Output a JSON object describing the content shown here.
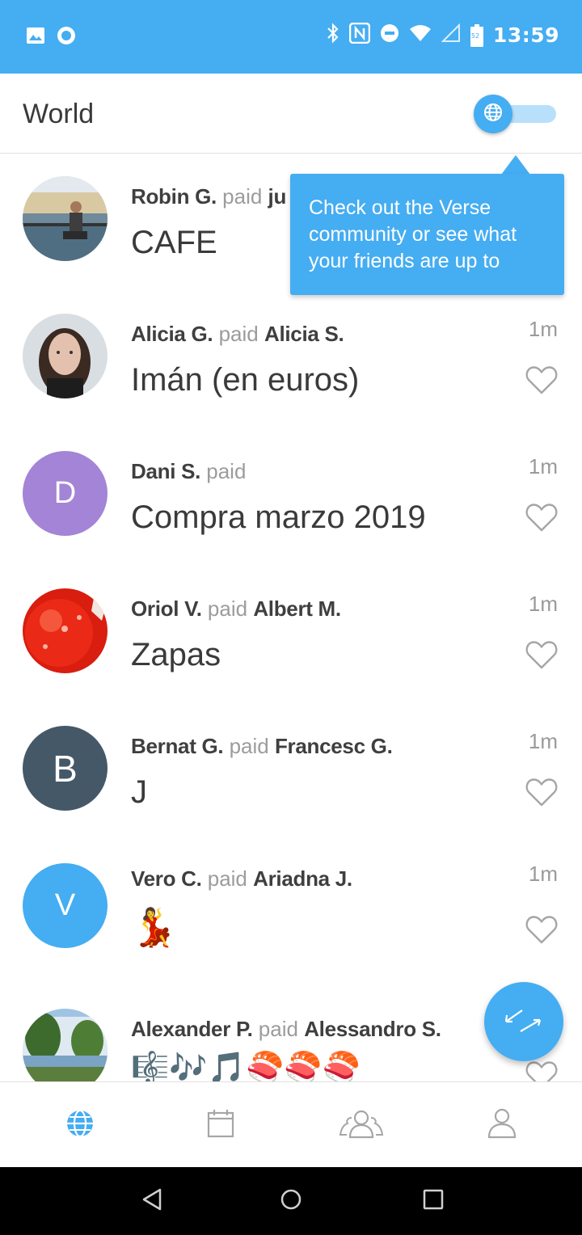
{
  "status_bar": {
    "time": "13:59",
    "battery_level": "52",
    "icons": [
      "image-icon",
      "circle-notification-icon",
      "bluetooth-icon",
      "nfc-icon",
      "do-not-disturb-icon",
      "wifi-icon",
      "signal-icon",
      "battery-icon"
    ]
  },
  "header": {
    "title": "World",
    "toggle_icon": "globe-icon",
    "toggle_state": "on"
  },
  "tooltip": {
    "text": "Check out the Verse community or see what your friends are up to"
  },
  "feed": [
    {
      "payer": "Robin G.",
      "verb": "paid",
      "payee": "ju",
      "note": "CAFE",
      "time": "",
      "avatar": {
        "type": "photo",
        "description": "person-by-water"
      }
    },
    {
      "payer": "Alicia G.",
      "verb": "paid",
      "payee": "Alicia S.",
      "note": "Imán (en euros)",
      "time": "1m",
      "avatar": {
        "type": "photo",
        "description": "woman-portrait"
      }
    },
    {
      "payer": "Dani S.",
      "verb": "paid",
      "payee": "",
      "note": "Compra marzo 2019",
      "time": "1m",
      "avatar": {
        "type": "letter",
        "letter": "D",
        "color": "#a484d6"
      }
    },
    {
      "payer": "Oriol V.",
      "verb": "paid",
      "payee": "Albert M.",
      "note": "Zapas",
      "time": "1m",
      "avatar": {
        "type": "photo",
        "description": "red-balloon"
      }
    },
    {
      "payer": "Bernat G.",
      "verb": "paid",
      "payee": "Francesc G.",
      "note": "J",
      "time": "1m",
      "avatar": {
        "type": "letter",
        "letter": "B",
        "color": "#455868"
      }
    },
    {
      "payer": "Vero C.",
      "verb": "paid",
      "payee": "Ariadna J.",
      "note": "💃",
      "time": "1m",
      "avatar": {
        "type": "letter",
        "letter": "V",
        "color": "#45adf2"
      }
    },
    {
      "payer": "Alexander P.",
      "verb": "paid",
      "payee": "Alessandro S.",
      "note": "🎼🎶🎵🍣🍣🍣",
      "time": "",
      "avatar": {
        "type": "photo",
        "description": "trees-and-lake"
      }
    }
  ],
  "fab": {
    "icon": "transfer-arrows-icon"
  },
  "bottom_nav": [
    {
      "name": "world",
      "icon": "globe-icon",
      "active": true
    },
    {
      "name": "calendar",
      "icon": "calendar-icon",
      "active": false
    },
    {
      "name": "friends",
      "icon": "group-icon",
      "active": false
    },
    {
      "name": "profile",
      "icon": "person-icon",
      "active": false
    }
  ],
  "colors": {
    "accent": "#45adf2",
    "text_primary": "#3a3a3a",
    "text_muted": "#9c9c9c",
    "icon_inactive": "#a6a6a6"
  }
}
